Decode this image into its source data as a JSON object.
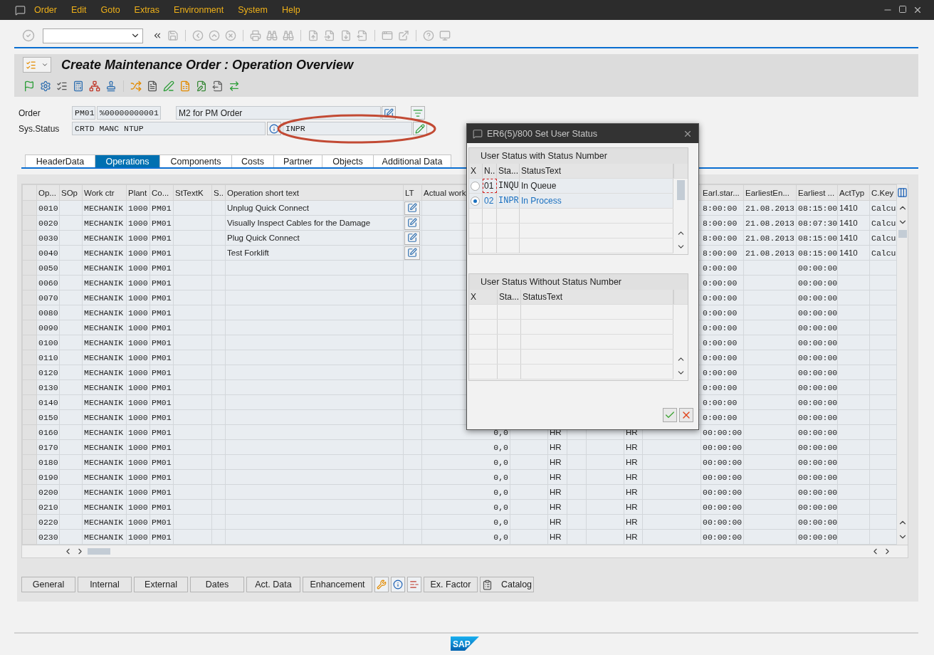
{
  "menu": [
    "Order",
    "Edit",
    "Goto",
    "Extras",
    "Environment",
    "System",
    "Help"
  ],
  "title": "Create Maintenance Order : Operation Overview",
  "order": {
    "label": "Order",
    "type": "PM01",
    "number": "%00000000001",
    "description": "M2 for PM Order"
  },
  "sys_status": {
    "label": "Sys.Status",
    "system_status": "CRTD MANC NTUP",
    "user_status": "INPR"
  },
  "tabs": [
    {
      "label": "HeaderData",
      "selected": false
    },
    {
      "label": "Operations",
      "selected": true
    },
    {
      "label": "Components",
      "selected": false
    },
    {
      "label": "Costs",
      "selected": false
    },
    {
      "label": "Partner",
      "selected": false
    },
    {
      "label": "Objects",
      "selected": false
    },
    {
      "label": "Additional Data",
      "selected": false
    }
  ],
  "table": {
    "columns": [
      "Op...",
      "SOp",
      "Work ctr",
      "Plant",
      "Co...",
      "StTextK",
      "S..",
      "Operation short text",
      "LT",
      "Actual work",
      "Earl.star...",
      "EarliestEn...",
      "Earliest ...",
      "ActTyp",
      "C.Key"
    ],
    "rows": [
      {
        "op": "0010",
        "work_ctr": "MECHANIK",
        "plant": "1000",
        "control_key": "PM01",
        "text": "Unplug Quick Connect",
        "lt": true,
        "earl_start": "8:00:00",
        "earliest_end": "21.08.2013",
        "earliest_time": "08:15:00",
        "act_typ": "1410",
        "c_key": "Calcu"
      },
      {
        "op": "0020",
        "work_ctr": "MECHANIK",
        "plant": "1000",
        "control_key": "PM01",
        "text": "Visually Inspect Cables for the Damage",
        "lt": true,
        "earl_start": "8:00:00",
        "earliest_end": "21.08.2013",
        "earliest_time": "08:07:30",
        "act_typ": "1410",
        "c_key": "Calcu"
      },
      {
        "op": "0030",
        "work_ctr": "MECHANIK",
        "plant": "1000",
        "control_key": "PM01",
        "text": "Plug Quick Connect",
        "lt": true,
        "earl_start": "8:00:00",
        "earliest_end": "21.08.2013",
        "earliest_time": "08:15:00",
        "act_typ": "1410",
        "c_key": "Calcu"
      },
      {
        "op": "0040",
        "work_ctr": "MECHANIK",
        "plant": "1000",
        "control_key": "PM01",
        "text": "Test Forklift",
        "lt": true,
        "earl_start": "8:00:00",
        "earliest_end": "21.08.2013",
        "earliest_time": "08:15:00",
        "act_typ": "1410",
        "c_key": "Calcu"
      },
      {
        "op": "0050",
        "work_ctr": "MECHANIK",
        "plant": "1000",
        "control_key": "PM01",
        "lt": false,
        "earl_start": "0:00:00",
        "earliest_time": "00:00:00"
      },
      {
        "op": "0060",
        "work_ctr": "MECHANIK",
        "plant": "1000",
        "control_key": "PM01",
        "lt": false,
        "earl_start": "0:00:00",
        "earliest_time": "00:00:00"
      },
      {
        "op": "0070",
        "work_ctr": "MECHANIK",
        "plant": "1000",
        "control_key": "PM01",
        "lt": false,
        "earl_start": "0:00:00",
        "earliest_time": "00:00:00"
      },
      {
        "op": "0080",
        "work_ctr": "MECHANIK",
        "plant": "1000",
        "control_key": "PM01",
        "lt": false,
        "earl_start": "0:00:00",
        "earliest_time": "00:00:00"
      },
      {
        "op": "0090",
        "work_ctr": "MECHANIK",
        "plant": "1000",
        "control_key": "PM01",
        "lt": false,
        "earl_start": "0:00:00",
        "earliest_time": "00:00:00"
      },
      {
        "op": "0100",
        "work_ctr": "MECHANIK",
        "plant": "1000",
        "control_key": "PM01",
        "lt": false,
        "earl_start": "0:00:00",
        "earliest_time": "00:00:00"
      },
      {
        "op": "0110",
        "work_ctr": "MECHANIK",
        "plant": "1000",
        "control_key": "PM01",
        "lt": false,
        "earl_start": "0:00:00",
        "earliest_time": "00:00:00"
      },
      {
        "op": "0120",
        "work_ctr": "MECHANIK",
        "plant": "1000",
        "control_key": "PM01",
        "lt": false,
        "earl_start": "0:00:00",
        "earliest_time": "00:00:00"
      },
      {
        "op": "0130",
        "work_ctr": "MECHANIK",
        "plant": "1000",
        "control_key": "PM01",
        "lt": false,
        "earl_start": "0:00:00",
        "earliest_time": "00:00:00"
      },
      {
        "op": "0140",
        "work_ctr": "MECHANIK",
        "plant": "1000",
        "control_key": "PM01",
        "lt": false,
        "earl_start": "0:00:00",
        "earliest_time": "00:00:00"
      },
      {
        "op": "0150",
        "work_ctr": "MECHANIK",
        "plant": "1000",
        "control_key": "PM01",
        "lt": false,
        "earl_start": "0:00:00",
        "earliest_time": "00:00:00"
      },
      {
        "op": "0160",
        "work_ctr": "MECHANIK",
        "plant": "1000",
        "control_key": "PM01",
        "lt": false,
        "actual_work": "0,0",
        "column_13": "HR",
        "column_16": "HR",
        "earl_start": "00:00:00",
        "earliest_time": "00:00:00"
      },
      {
        "op": "0170",
        "work_ctr": "MECHANIK",
        "plant": "1000",
        "control_key": "PM01",
        "lt": false,
        "actual_work": "0,0",
        "column_13": "HR",
        "column_16": "HR",
        "earl_start": "00:00:00",
        "earliest_time": "00:00:00"
      },
      {
        "op": "0180",
        "work_ctr": "MECHANIK",
        "plant": "1000",
        "control_key": "PM01",
        "lt": false,
        "actual_work": "0,0",
        "column_13": "HR",
        "column_16": "HR",
        "earl_start": "00:00:00",
        "earliest_time": "00:00:00"
      },
      {
        "op": "0190",
        "work_ctr": "MECHANIK",
        "plant": "1000",
        "control_key": "PM01",
        "lt": false,
        "actual_work": "0,0",
        "column_13": "HR",
        "column_16": "HR",
        "earl_start": "00:00:00",
        "earliest_time": "00:00:00"
      },
      {
        "op": "0200",
        "work_ctr": "MECHANIK",
        "plant": "1000",
        "control_key": "PM01",
        "lt": false,
        "actual_work": "0,0",
        "column_13": "HR",
        "column_16": "HR",
        "earl_start": "00:00:00",
        "earliest_time": "00:00:00"
      },
      {
        "op": "0210",
        "work_ctr": "MECHANIK",
        "plant": "1000",
        "control_key": "PM01",
        "lt": false,
        "actual_work": "0,0",
        "column_13": "HR",
        "column_16": "HR",
        "earl_start": "00:00:00",
        "earliest_time": "00:00:00"
      },
      {
        "op": "0220",
        "work_ctr": "MECHANIK",
        "plant": "1000",
        "control_key": "PM01",
        "lt": false,
        "actual_work": "0,0",
        "column_13": "HR",
        "column_16": "HR",
        "earl_start": "00:00:00",
        "earliest_time": "00:00:00"
      },
      {
        "op": "0230",
        "work_ctr": "MECHANIK",
        "plant": "1000",
        "control_key": "PM01",
        "lt": false,
        "actual_work": "0,0",
        "column_13": "HR",
        "column_16": "HR",
        "earl_start": "00:00:00",
        "earliest_time": "00:00:00"
      }
    ]
  },
  "bottom_buttons": [
    {
      "kind": "text",
      "label": "General"
    },
    {
      "kind": "text",
      "label": "Internal"
    },
    {
      "kind": "text",
      "label": "External"
    },
    {
      "kind": "text",
      "label": "Dates"
    },
    {
      "kind": "text",
      "label": "Act. Data"
    },
    {
      "kind": "text",
      "label": "Enhancement"
    },
    {
      "kind": "tools"
    },
    {
      "kind": "info"
    },
    {
      "kind": "remove"
    },
    {
      "kind": "text",
      "label": "Ex. Factor"
    },
    {
      "kind": "catalog",
      "label": "Catalog"
    }
  ],
  "dialog": {
    "title": "ER6(5)/800 Set User Status",
    "sections": [
      {
        "title": "User Status with Status Number",
        "columns": [
          "X",
          "N..",
          "Sta...",
          "StatusText"
        ],
        "rows": [
          {
            "number": "01",
            "status": "INQU",
            "text": "In Queue",
            "selected": false,
            "focused": true
          },
          {
            "number": "02",
            "status": "INPR",
            "text": "In Process",
            "selected": true,
            "focused": false
          }
        ]
      },
      {
        "title": "User Status Without Status Number",
        "columns": [
          "X",
          "Sta...",
          "StatusText"
        ]
      }
    ]
  },
  "footer": {
    "logo": "SAP"
  }
}
